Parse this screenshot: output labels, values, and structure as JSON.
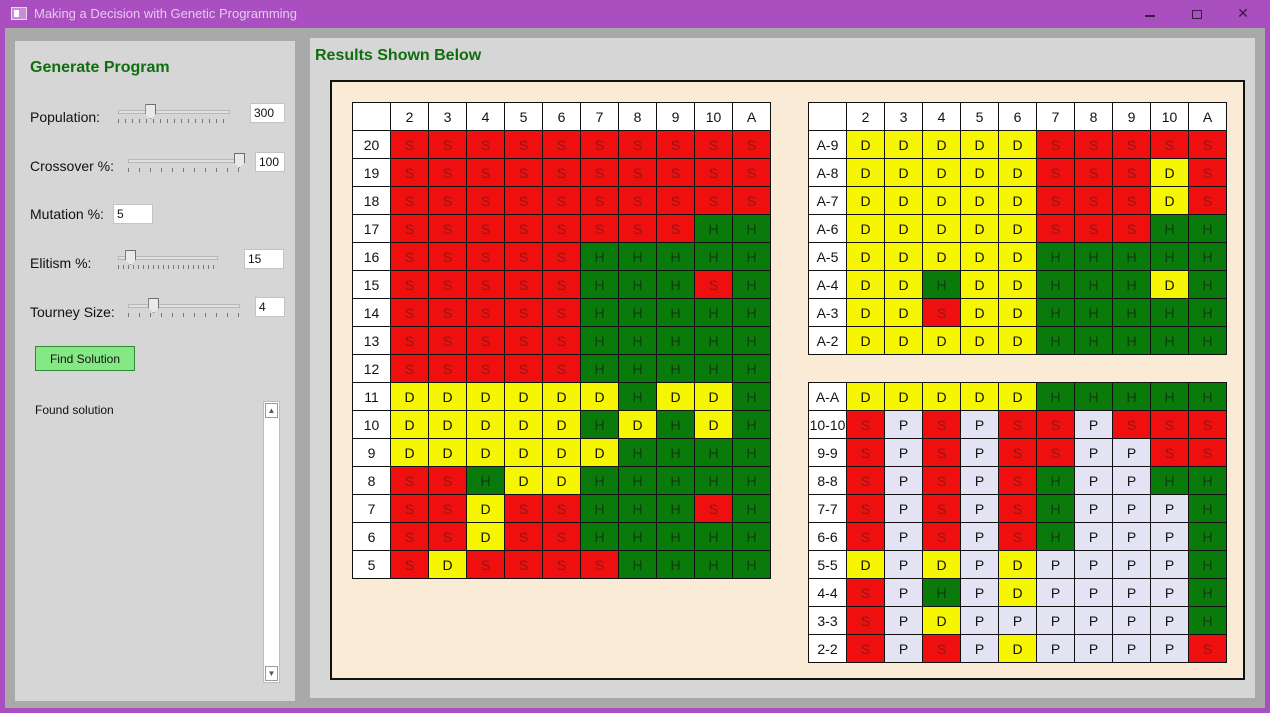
{
  "window": {
    "title": "Making a Decision with Genetic Programming",
    "controls": {
      "minimize": "—",
      "maximize": "☐",
      "close": "✕"
    }
  },
  "left_panel": {
    "title": "Generate Program",
    "population": {
      "label": "Population:",
      "value": "300",
      "slider_fraction": 0.27
    },
    "crossover": {
      "label": "Crossover %:",
      "value": "100",
      "slider_fraction": 1.0
    },
    "mutation": {
      "label": "Mutation %:",
      "value": "5"
    },
    "elitism": {
      "label": "Elitism %:",
      "value": "15",
      "slider_fraction": 0.08
    },
    "tourney": {
      "label": "Tourney Size:",
      "value": "4",
      "slider_fraction": 0.2
    },
    "find_button": "Find Solution",
    "output_text": "Found solution"
  },
  "results": {
    "title": "Results Shown Below",
    "columns": [
      "2",
      "3",
      "4",
      "5",
      "6",
      "7",
      "8",
      "9",
      "10",
      "A"
    ],
    "hard_totals": [
      {
        "label": "20",
        "cells": [
          "S",
          "S",
          "S",
          "S",
          "S",
          "S",
          "S",
          "S",
          "S",
          "S"
        ]
      },
      {
        "label": "19",
        "cells": [
          "S",
          "S",
          "S",
          "S",
          "S",
          "S",
          "S",
          "S",
          "S",
          "S"
        ]
      },
      {
        "label": "18",
        "cells": [
          "S",
          "S",
          "S",
          "S",
          "S",
          "S",
          "S",
          "S",
          "S",
          "S"
        ]
      },
      {
        "label": "17",
        "cells": [
          "S",
          "S",
          "S",
          "S",
          "S",
          "S",
          "S",
          "S",
          "H",
          "H"
        ]
      },
      {
        "label": "16",
        "cells": [
          "S",
          "S",
          "S",
          "S",
          "S",
          "H",
          "H",
          "H",
          "H",
          "H"
        ]
      },
      {
        "label": "15",
        "cells": [
          "S",
          "S",
          "S",
          "S",
          "S",
          "H",
          "H",
          "H",
          "S",
          "H"
        ]
      },
      {
        "label": "14",
        "cells": [
          "S",
          "S",
          "S",
          "S",
          "S",
          "H",
          "H",
          "H",
          "H",
          "H"
        ]
      },
      {
        "label": "13",
        "cells": [
          "S",
          "S",
          "S",
          "S",
          "S",
          "H",
          "H",
          "H",
          "H",
          "H"
        ]
      },
      {
        "label": "12",
        "cells": [
          "S",
          "S",
          "S",
          "S",
          "S",
          "H",
          "H",
          "H",
          "H",
          "H"
        ]
      },
      {
        "label": "11",
        "cells": [
          "D",
          "D",
          "D",
          "D",
          "D",
          "D",
          "H",
          "D",
          "D",
          "H"
        ]
      },
      {
        "label": "10",
        "cells": [
          "D",
          "D",
          "D",
          "D",
          "D",
          "H",
          "D",
          "H",
          "D",
          "H"
        ]
      },
      {
        "label": "9",
        "cells": [
          "D",
          "D",
          "D",
          "D",
          "D",
          "D",
          "H",
          "H",
          "H",
          "H"
        ]
      },
      {
        "label": "8",
        "cells": [
          "S",
          "S",
          "H",
          "D",
          "D",
          "H",
          "H",
          "H",
          "H",
          "H"
        ]
      },
      {
        "label": "7",
        "cells": [
          "S",
          "S",
          "D",
          "S",
          "S",
          "H",
          "H",
          "H",
          "S",
          "H"
        ]
      },
      {
        "label": "6",
        "cells": [
          "S",
          "S",
          "D",
          "S",
          "S",
          "H",
          "H",
          "H",
          "H",
          "H"
        ]
      },
      {
        "label": "5",
        "cells": [
          "S",
          "D",
          "S",
          "S",
          "S",
          "S",
          "H",
          "H",
          "H",
          "H"
        ]
      }
    ],
    "soft_totals": [
      {
        "label": "A-9",
        "cells": [
          "D",
          "D",
          "D",
          "D",
          "D",
          "S",
          "S",
          "S",
          "S",
          "S"
        ]
      },
      {
        "label": "A-8",
        "cells": [
          "D",
          "D",
          "D",
          "D",
          "D",
          "S",
          "S",
          "S",
          "D",
          "S"
        ]
      },
      {
        "label": "A-7",
        "cells": [
          "D",
          "D",
          "D",
          "D",
          "D",
          "S",
          "S",
          "S",
          "D",
          "S"
        ]
      },
      {
        "label": "A-6",
        "cells": [
          "D",
          "D",
          "D",
          "D",
          "D",
          "S",
          "S",
          "S",
          "H",
          "H"
        ]
      },
      {
        "label": "A-5",
        "cells": [
          "D",
          "D",
          "D",
          "D",
          "D",
          "H",
          "H",
          "H",
          "H",
          "H"
        ]
      },
      {
        "label": "A-4",
        "cells": [
          "D",
          "D",
          "H",
          "D",
          "D",
          "H",
          "H",
          "H",
          "D",
          "H"
        ]
      },
      {
        "label": "A-3",
        "cells": [
          "D",
          "D",
          "S",
          "D",
          "D",
          "H",
          "H",
          "H",
          "H",
          "H"
        ]
      },
      {
        "label": "A-2",
        "cells": [
          "D",
          "D",
          "D",
          "D",
          "D",
          "H",
          "H",
          "H",
          "H",
          "H"
        ]
      }
    ],
    "pairs": [
      {
        "label": "A-A",
        "cells": [
          "D",
          "D",
          "D",
          "D",
          "D",
          "H",
          "H",
          "H",
          "H",
          "H"
        ]
      },
      {
        "label": "10-10",
        "cells": [
          "S",
          "P",
          "S",
          "P",
          "S",
          "S",
          "P",
          "S",
          "S",
          "S"
        ]
      },
      {
        "label": "9-9",
        "cells": [
          "S",
          "P",
          "S",
          "P",
          "S",
          "S",
          "P",
          "P",
          "S",
          "S"
        ]
      },
      {
        "label": "8-8",
        "cells": [
          "S",
          "P",
          "S",
          "P",
          "S",
          "H",
          "P",
          "P",
          "H",
          "H"
        ]
      },
      {
        "label": "7-7",
        "cells": [
          "S",
          "P",
          "S",
          "P",
          "S",
          "H",
          "P",
          "P",
          "P",
          "H"
        ]
      },
      {
        "label": "6-6",
        "cells": [
          "S",
          "P",
          "S",
          "P",
          "S",
          "H",
          "P",
          "P",
          "P",
          "H"
        ]
      },
      {
        "label": "5-5",
        "cells": [
          "D",
          "P",
          "D",
          "P",
          "D",
          "P",
          "P",
          "P",
          "P",
          "H"
        ]
      },
      {
        "label": "4-4",
        "cells": [
          "S",
          "P",
          "H",
          "P",
          "D",
          "P",
          "P",
          "P",
          "P",
          "H"
        ]
      },
      {
        "label": "3-3",
        "cells": [
          "S",
          "P",
          "D",
          "P",
          "P",
          "P",
          "P",
          "P",
          "P",
          "H"
        ]
      },
      {
        "label": "2-2",
        "cells": [
          "S",
          "P",
          "S",
          "P",
          "D",
          "P",
          "P",
          "P",
          "P",
          "S"
        ]
      }
    ],
    "colors": {
      "S": "#ef0f0f",
      "H": "#0a7a0a",
      "D": "#f6f600",
      "P": "#e3e3f3"
    }
  }
}
